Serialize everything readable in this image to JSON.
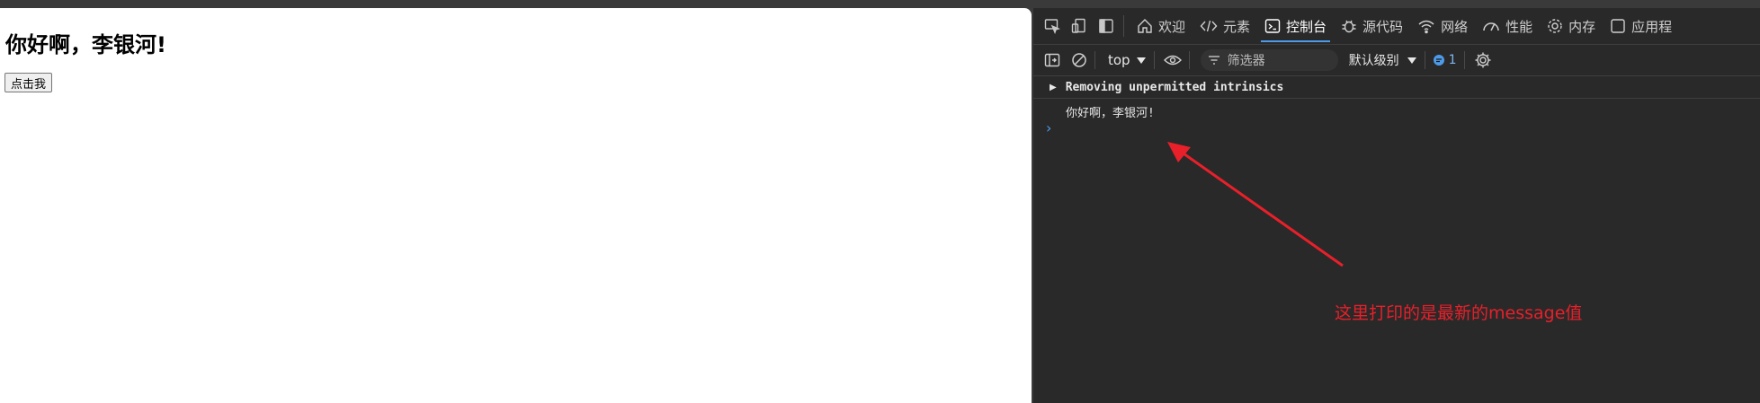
{
  "page": {
    "heading": "你好啊，李银河!",
    "button_label": "点击我"
  },
  "devtools": {
    "tabs": [
      {
        "label": "欢迎",
        "icon": "home-icon"
      },
      {
        "label": "元素",
        "icon": "code-icon"
      },
      {
        "label": "控制台",
        "icon": "console-icon",
        "active": true
      },
      {
        "label": "源代码",
        "icon": "bug-icon"
      },
      {
        "label": "网络",
        "icon": "wifi-icon"
      },
      {
        "label": "性能",
        "icon": "gauge-icon"
      },
      {
        "label": "内存",
        "icon": "cog-icon"
      },
      {
        "label": "应用程",
        "icon": "app-icon"
      }
    ],
    "toolbar": {
      "context": "top",
      "filter_placeholder": "筛选器",
      "levels": "默认级别",
      "message_count": "1"
    },
    "console": {
      "group_text": "Removing unpermitted intrinsics",
      "log_text": "你好啊，李银河!",
      "prompt": "›"
    }
  },
  "annotation": {
    "text": "这里打印的是最新的message值",
    "color": "#e8202a"
  },
  "colors": {
    "accent": "#4d9be8",
    "devtools_bg": "#292929",
    "annotation_red": "#e8202a"
  }
}
